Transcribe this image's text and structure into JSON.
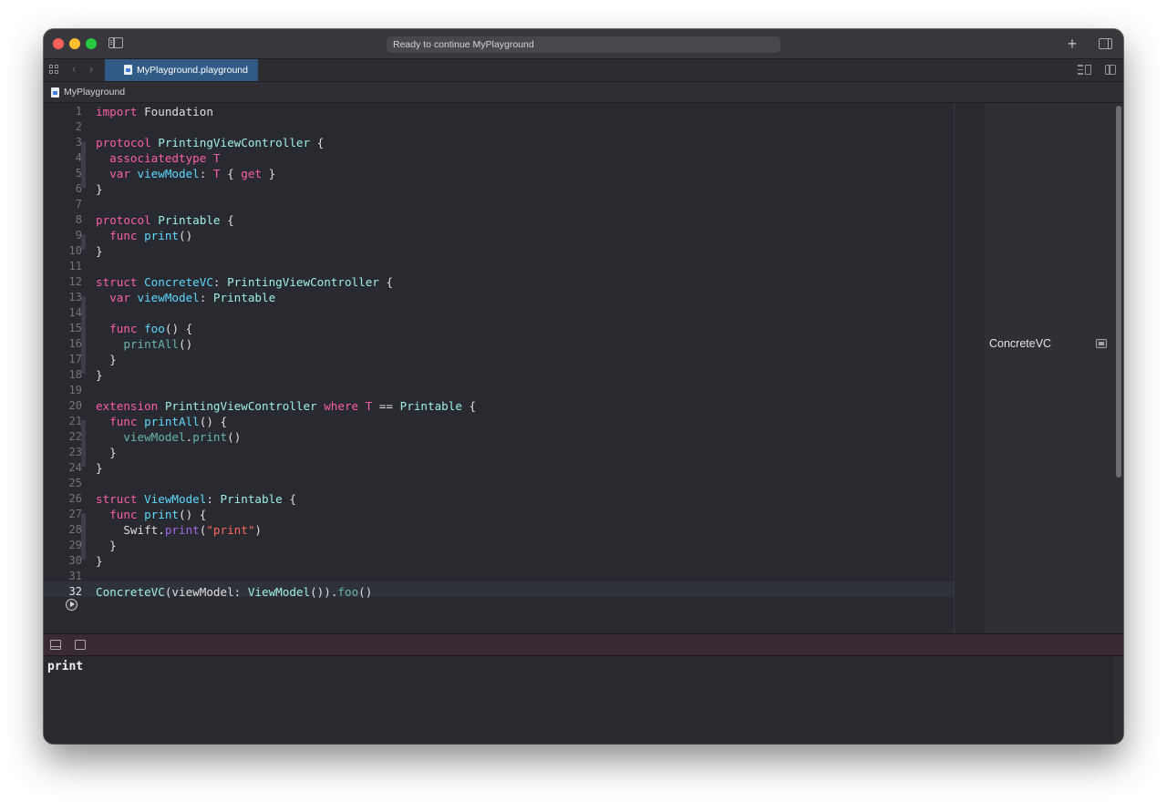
{
  "window": {
    "activity_status": "Ready to continue MyPlayground",
    "new_tab_symbol": "+"
  },
  "tabbar": {
    "active_tab_label": "MyPlayground.playground",
    "back_symbol": "‹",
    "forward_symbol": "›"
  },
  "jumpbar": {
    "breadcrumb_label": "MyPlayground"
  },
  "editor": {
    "current_line": 32,
    "lines": [
      {
        "n": "1",
        "segs": [
          [
            "kw",
            "import"
          ],
          [
            "",
            " Foundation"
          ]
        ]
      },
      {
        "n": "2",
        "segs": []
      },
      {
        "n": "3",
        "segs": [
          [
            "kw",
            "protocol"
          ],
          [
            "",
            ""
          ],
          [
            "ty",
            " PrintingViewController"
          ],
          [
            "",
            " {"
          ]
        ]
      },
      {
        "n": "4",
        "segs": [
          [
            "",
            "  "
          ],
          [
            "kw",
            "associatedtype"
          ],
          [
            "kw",
            " T"
          ]
        ]
      },
      {
        "n": "5",
        "segs": [
          [
            "",
            "  "
          ],
          [
            "kw",
            "var"
          ],
          [
            "ty2",
            " viewModel"
          ],
          [
            "",
            ": "
          ],
          [
            "kw",
            "T"
          ],
          [
            "",
            " { "
          ],
          [
            "kw",
            "get"
          ],
          [
            "",
            " }"
          ]
        ]
      },
      {
        "n": "6",
        "segs": [
          [
            "",
            "}"
          ]
        ]
      },
      {
        "n": "7",
        "segs": []
      },
      {
        "n": "8",
        "segs": [
          [
            "kw",
            "protocol"
          ],
          [
            "ty",
            " Printable"
          ],
          [
            "",
            " {"
          ]
        ]
      },
      {
        "n": "9",
        "segs": [
          [
            "",
            "  "
          ],
          [
            "kw",
            "func"
          ],
          [
            "ty2",
            " print"
          ],
          [
            "",
            "()"
          ]
        ]
      },
      {
        "n": "10",
        "segs": [
          [
            "",
            "}"
          ]
        ]
      },
      {
        "n": "11",
        "segs": []
      },
      {
        "n": "12",
        "segs": [
          [
            "kw",
            "struct"
          ],
          [
            "ty2",
            " ConcreteVC"
          ],
          [
            "",
            ": "
          ],
          [
            "ty",
            "PrintingViewController"
          ],
          [
            "",
            " {"
          ]
        ]
      },
      {
        "n": "13",
        "segs": [
          [
            "",
            "  "
          ],
          [
            "kw",
            "var"
          ],
          [
            "ty2",
            " viewModel"
          ],
          [
            "",
            ": "
          ],
          [
            "ty",
            "Printable"
          ]
        ]
      },
      {
        "n": "14",
        "segs": []
      },
      {
        "n": "15",
        "segs": [
          [
            "",
            "  "
          ],
          [
            "kw",
            "func"
          ],
          [
            "ty2",
            " foo"
          ],
          [
            "",
            "() {"
          ]
        ]
      },
      {
        "n": "16",
        "segs": [
          [
            "",
            "    "
          ],
          [
            "fn",
            "printAll"
          ],
          [
            "",
            "()"
          ]
        ]
      },
      {
        "n": "17",
        "segs": [
          [
            "",
            "  }"
          ]
        ]
      },
      {
        "n": "18",
        "segs": [
          [
            "",
            "}"
          ]
        ]
      },
      {
        "n": "19",
        "segs": []
      },
      {
        "n": "20",
        "segs": [
          [
            "kw",
            "extension"
          ],
          [
            "ty",
            " PrintingViewController"
          ],
          [
            "kw",
            " where"
          ],
          [
            "kw",
            " T"
          ],
          [
            "",
            " == "
          ],
          [
            "ty",
            "Printable"
          ],
          [
            "",
            " {"
          ]
        ]
      },
      {
        "n": "21",
        "segs": [
          [
            "",
            "  "
          ],
          [
            "kw",
            "func"
          ],
          [
            "ty2",
            " printAll"
          ],
          [
            "",
            "() {"
          ]
        ]
      },
      {
        "n": "22",
        "segs": [
          [
            "",
            "    "
          ],
          [
            "fn",
            "viewModel"
          ],
          [
            "",
            "."
          ],
          [
            "fn",
            "print"
          ],
          [
            "",
            "()"
          ]
        ]
      },
      {
        "n": "23",
        "segs": [
          [
            "",
            "  }"
          ]
        ]
      },
      {
        "n": "24",
        "segs": [
          [
            "",
            "}"
          ]
        ]
      },
      {
        "n": "25",
        "segs": []
      },
      {
        "n": "26",
        "segs": [
          [
            "kw",
            "struct"
          ],
          [
            "ty2",
            " ViewModel"
          ],
          [
            "",
            ": "
          ],
          [
            "ty",
            "Printable"
          ],
          [
            "",
            " {"
          ]
        ]
      },
      {
        "n": "27",
        "segs": [
          [
            "",
            "  "
          ],
          [
            "kw",
            "func"
          ],
          [
            "ty2",
            " print"
          ],
          [
            "",
            "() {"
          ]
        ]
      },
      {
        "n": "28",
        "segs": [
          [
            "",
            "    Swift."
          ],
          [
            "pr",
            "print"
          ],
          [
            "",
            "("
          ],
          [
            "st",
            "\"print\""
          ],
          [
            "",
            ")"
          ]
        ]
      },
      {
        "n": "29",
        "segs": [
          [
            "",
            "  }"
          ]
        ]
      },
      {
        "n": "30",
        "segs": [
          [
            "",
            "}"
          ]
        ]
      },
      {
        "n": "31",
        "segs": []
      },
      {
        "n": "32",
        "segs": [
          [
            "ty",
            "ConcreteVC"
          ],
          [
            "",
            "(viewModel: "
          ],
          [
            "ty",
            "ViewModel"
          ],
          [
            "",
            "())."
          ],
          [
            "fn",
            "foo"
          ],
          [
            "",
            "()"
          ]
        ]
      }
    ]
  },
  "results": {
    "line_16_result": "ConcreteVC"
  },
  "console": {
    "output": "print"
  },
  "colors": {
    "keyword": "#fc5fa3",
    "type_name": "#9ef1dd",
    "declaration": "#5dd8ff",
    "other_name": "#67b7a4",
    "library_function": "#a167e6",
    "string": "#fc6a5d",
    "tab_active": "#315a87"
  },
  "icons": [
    "close-dot",
    "minimize-dot",
    "zoom-dot",
    "sidebar-icon",
    "plus-icon",
    "inspector-icon",
    "grid-icon",
    "chevron-left-icon",
    "chevron-right-icon",
    "playground-file-icon",
    "minimap-icon",
    "split-editor-icon",
    "run-icon",
    "quicklook-icon",
    "hide-debug-icon",
    "console-icon"
  ]
}
